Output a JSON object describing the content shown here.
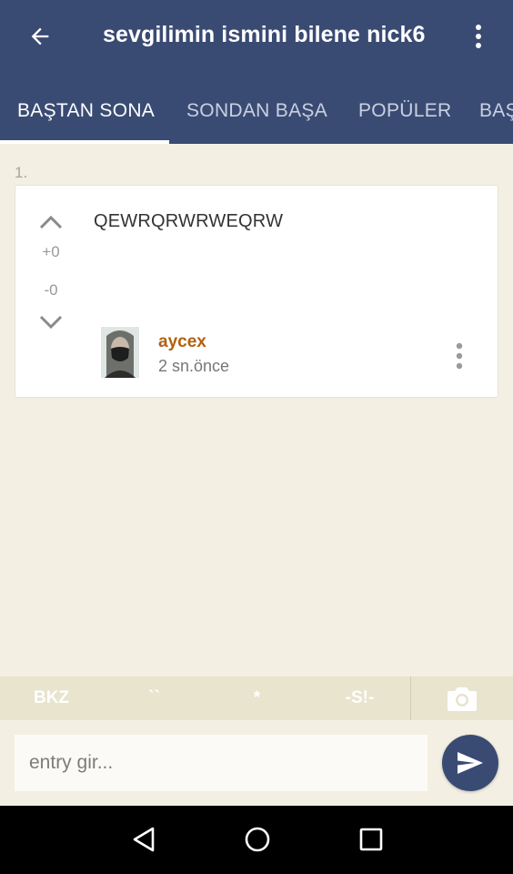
{
  "header": {
    "title": "sevgilimin ismini bilene nick6",
    "back_icon": "arrow-left-icon",
    "menu_icon": "more-vert-icon"
  },
  "tabs": [
    {
      "label": "BAŞTAN SONA",
      "active": true
    },
    {
      "label": "SONDAN BAŞA",
      "active": false
    },
    {
      "label": "POPÜLER",
      "active": false
    },
    {
      "label": "BAŞ",
      "active": false
    }
  ],
  "entry": {
    "number": "1.",
    "text": "QEWRQRWRWEQRW",
    "upvotes": "+0",
    "downvotes": "-0",
    "author": "aycex",
    "time": "2 sn.önce"
  },
  "format_bar": {
    "bkz": "BKZ",
    "quote": "``",
    "star": "*",
    "spoiler": "-S!-",
    "camera_icon": "camera-icon"
  },
  "composer": {
    "placeholder": "entry gir...",
    "value": "",
    "send_icon": "send-icon"
  },
  "system_nav": {
    "back_icon": "triangle-back-icon",
    "home_icon": "circle-home-icon",
    "recents_icon": "square-recents-icon"
  },
  "colors": {
    "primary": "#3a4b73",
    "background": "#f3f0e3",
    "author": "#b06212",
    "format_bar": "#e8e4ce"
  }
}
